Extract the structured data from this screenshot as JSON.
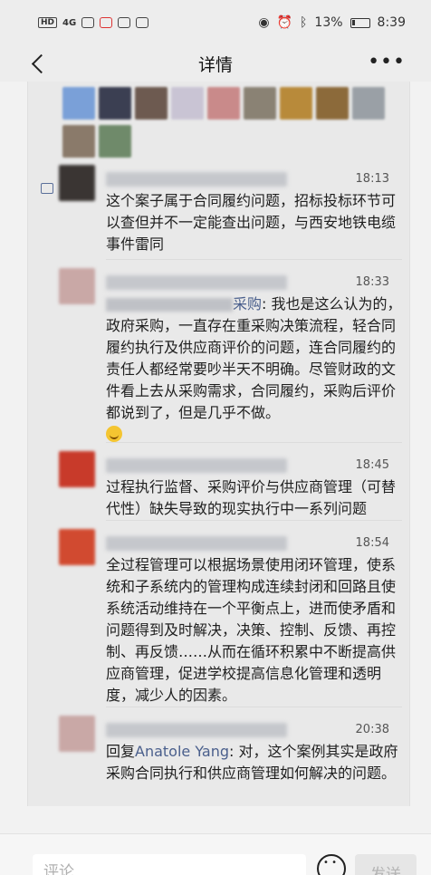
{
  "status_bar": {
    "badge_hd": "HD",
    "signal": "4G",
    "battery": "13%",
    "time": "8:39"
  },
  "nav": {
    "title": "详情"
  },
  "like_avatars": [
    {
      "color": "#7aa0d8"
    },
    {
      "color": "#3b3f52"
    },
    {
      "color": "#6d5a50"
    },
    {
      "color": "#c9c4d4"
    },
    {
      "color": "#c98a8a"
    },
    {
      "color": "#8a8274"
    },
    {
      "color": "#b88a3a"
    },
    {
      "color": "#8c6a3a"
    },
    {
      "color": "#9aa0a6"
    },
    {
      "color": "#8a7a6a"
    },
    {
      "color": "#6f8a6a"
    }
  ],
  "comments": [
    {
      "time": "18:13",
      "avatar_color": "#3a3533",
      "text": "这个案子属于合同履约问题，招标投标环节可以查但并不一定能查出问题，与西安地铁电缆事件雷同"
    },
    {
      "time": "18:33",
      "avatar_color": "#c9a8a6",
      "mention": "采购",
      "text": ": 我也是这么认为的，政府采购，一直存在重采购决策流程，轻合同履约执行及供应商评价的问题，连合同履约的责任人都经常要吵半天不明确。尽管财政的文件看上去从采购需求，合同履约，采购后评价都说到了，但是几乎不做。"
    },
    {
      "time": "18:45",
      "avatar_color": "#c83a2a",
      "text": "过程执行监督、采购评价与供应商管理（可替代性）缺失导致的现实执行中一系列问题"
    },
    {
      "time": "18:54",
      "avatar_color": "#d14a30",
      "text": "全过程管理可以根据场景使用闭环管理，使系统和子系统内的管理构成连续封闭和回路且使系统活动维持在一个平衡点上，进而使矛盾和问题得到及时解决，决策、控制、反馈、再控制、再反馈……从而在循环积累中不断提高供应商管理，促进学校提高信息化管理和透明度，减少人的因素。"
    },
    {
      "time": "20:38",
      "avatar_color": "#c9a8a6",
      "reply_prefix": "回复",
      "reply_to": "Anatole Yang",
      "text": ": 对，这个案例其实是政府采购合同执行和供应商管理如何解决的问题。"
    }
  ],
  "input": {
    "placeholder": "评论",
    "send_label": "发送"
  }
}
